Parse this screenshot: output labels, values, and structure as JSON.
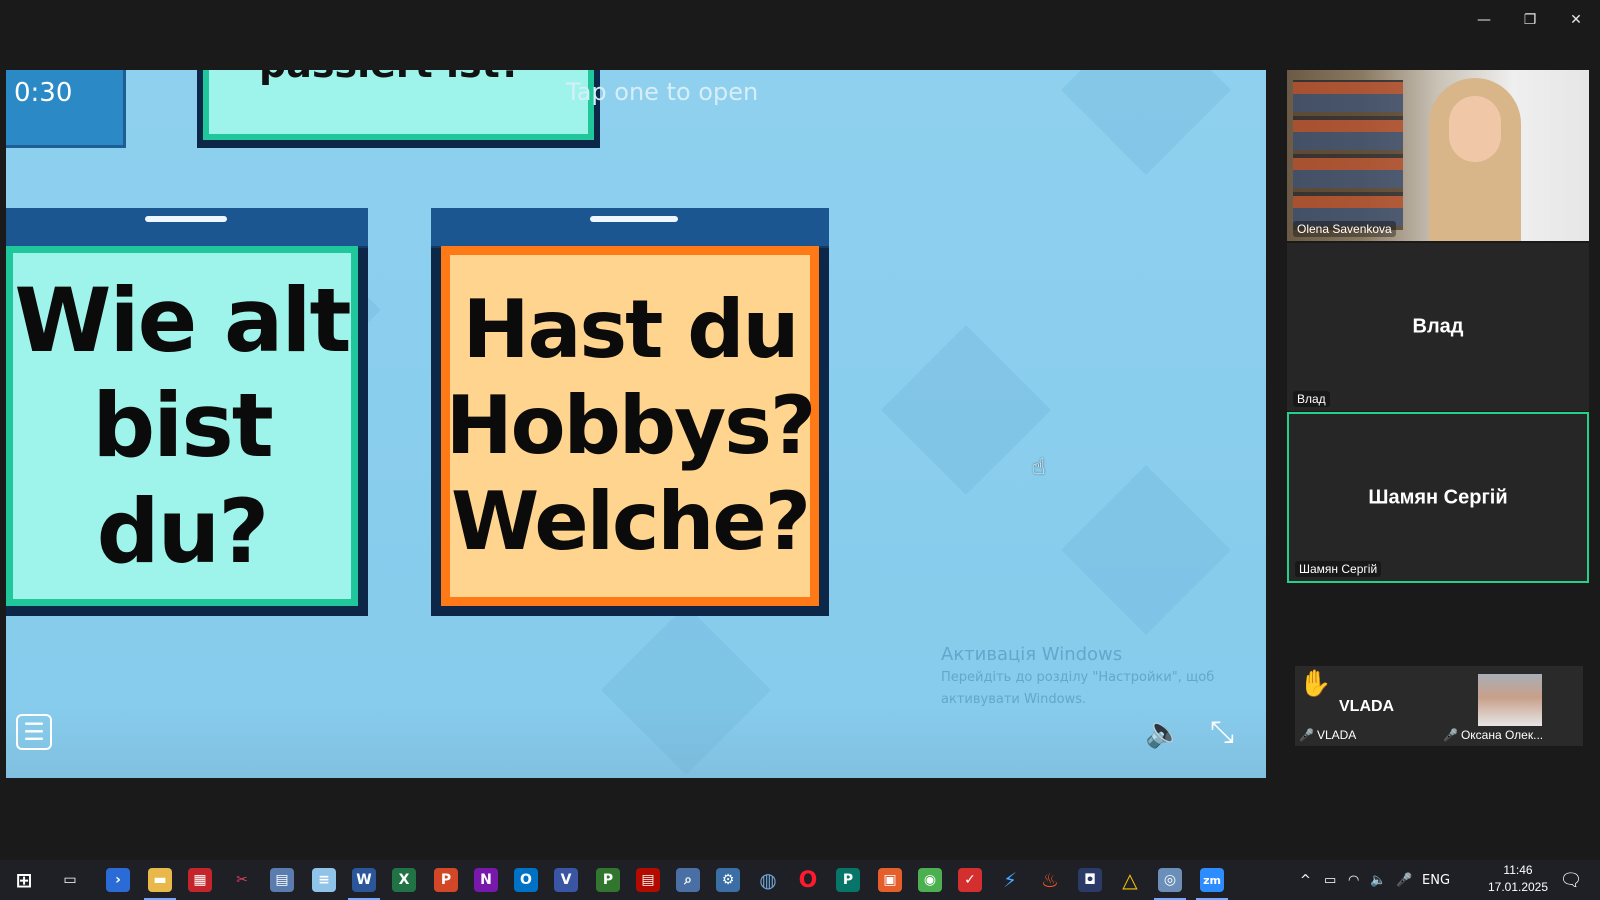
{
  "window": {
    "minimize_icon": "minimize-icon",
    "restore_icon": "restore-icon",
    "close_icon": "close-icon"
  },
  "share": {
    "timer": "0:30",
    "top_card_text": "passiert ist?",
    "tap_hint": "Tap one to open",
    "card_19_text": "Wie alt\nbist du?",
    "card_20_text": "Hast du\nHobbys?\nWelche?",
    "watermark_title": "Активація Windows",
    "watermark_line1": "Перейдіть до розділу \"Настройки\", щоб",
    "watermark_line2": "активувати Windows."
  },
  "participants": {
    "olena": {
      "name": "Olena Savenkova"
    },
    "vlad": {
      "center": "Влад",
      "name": "Влад"
    },
    "shamyan": {
      "center": "Шамян Сергій",
      "name": "Шамян Сергій"
    },
    "vlada": {
      "center": "VLADA",
      "name": "VLADA"
    },
    "oksana": {
      "name": "Оксана Олек..."
    }
  },
  "taskbar": {
    "lang": "ENG",
    "time": "11:46",
    "date": "17.01.2025",
    "apps": [
      "start-icon",
      "task-view-icon",
      "powershell-icon",
      "file-explorer-icon",
      "red-app-icon",
      "snipping-tool-icon",
      "calculator-icon",
      "notepad-icon",
      "word-icon",
      "excel-icon",
      "powerpoint-icon",
      "onenote-icon",
      "outlook-icon",
      "visio-icon",
      "project-icon",
      "pdf-icon",
      "search-tool-icon",
      "control-panel-icon",
      "globe-icon",
      "opera-icon",
      "publisher-icon",
      "zip-icon",
      "chrome-icon",
      "acrobat-icon",
      "thunder-icon",
      "fire-icon",
      "camera-icon",
      "drive-icon",
      "network-icon",
      "zoom-icon"
    ]
  },
  "colors": {
    "accent_active_speaker": "#23d18b",
    "card_19_border": "#1fc79a",
    "card_20_border": "#ff7a17",
    "share_bg": "#8ed0ee"
  }
}
